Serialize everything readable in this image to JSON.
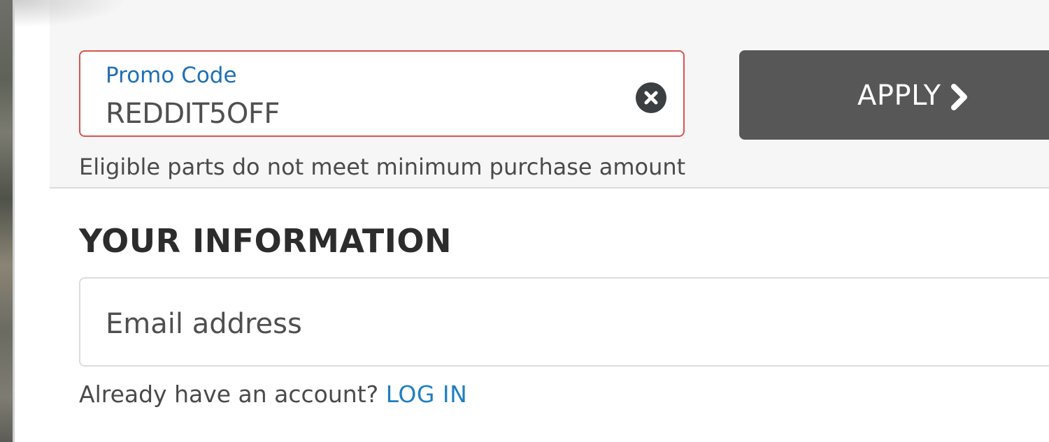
{
  "promo": {
    "label": "Promo Code",
    "value": "REDDIT5OFF",
    "clear_icon": "close-circle-icon",
    "apply_label": "APPLY",
    "apply_icon": "chevron-right-icon",
    "error_message": "Eligible parts do not meet minimum purchase amount",
    "error_border_color": "#d9534f"
  },
  "your_information": {
    "heading": "YOUR INFORMATION",
    "email_placeholder": "Email address",
    "account_prompt": "Already have an account?",
    "login_link": "LOG IN",
    "link_color": "#1f7fc0"
  }
}
